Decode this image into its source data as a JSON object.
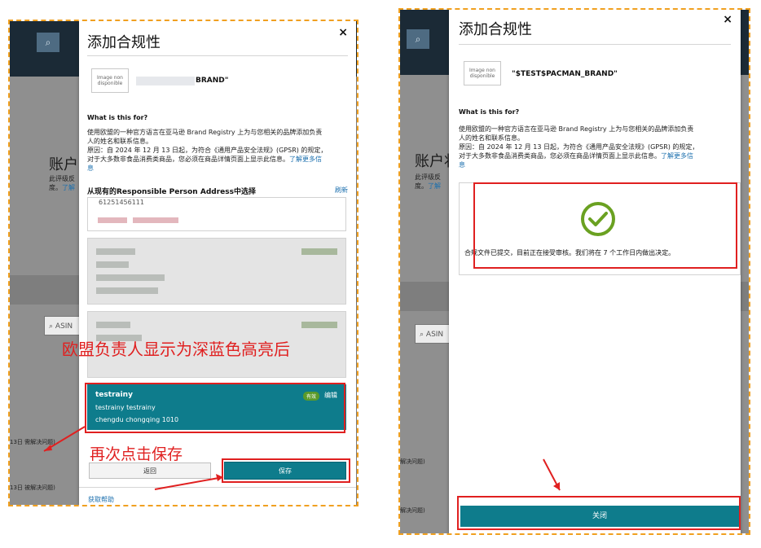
{
  "left": {
    "background": {
      "title_partial": "账户",
      "sub_partial": "此评级反",
      "sub_partial2": "度。",
      "sub_link": "了解",
      "asin_placeholder": "ASIN",
      "note1": "13日 需解决问题)",
      "note2": "13日 被解决问题)"
    },
    "modal": {
      "title": "添加合规性",
      "close": "×",
      "image_placeholder": "Image non disponible",
      "brand_suffix": "BRAND\"",
      "what_for": "What is this for?",
      "desc_line1": "使用欧盟的一种官方语言在亚马逊 Brand Registry 上为与您相关的品牌添加负责",
      "desc_line2": "人的姓名和联系信息。",
      "desc_line3": "原因：自 2024 年 12 月 13 日起，为符合《通用产品安全法规》(GPSR) 的规定，",
      "desc_line4": "对于大多数非食品消费类商品，您必须在商品详情页面上显示此信息。",
      "learn_more": "了解更多信",
      "learn_more2": "息",
      "select_heading": "从现有的Responsible Person Address中选择",
      "refresh": "刷新",
      "phone": "61251456111",
      "selected": {
        "name": "testrainy",
        "badge": "有效",
        "edit": "编辑",
        "line1": "testrainy testrainy",
        "line2": "chengdu chongqing 1010"
      },
      "back_button": "返回",
      "save_button": "保存",
      "help": "获取帮助"
    },
    "annotations": {
      "highlight_text": "欧盟负责人显示为深蓝色高亮后",
      "click_save_text": "再次点击保存"
    }
  },
  "right": {
    "background": {
      "title_partial": "账户状",
      "sub_partial": "此评级反",
      "sub_partial2": "度。",
      "sub_link": "了解",
      "asin_placeholder": "ASIN",
      "note1": "解决问题)",
      "note2": "解决问题)"
    },
    "modal": {
      "title": "添加合规性",
      "close": "×",
      "image_placeholder": "Image non disponible",
      "brand": "\"$TEST$PACMAN_BRAND\"",
      "what_for": "What is this for?",
      "desc_line1": "使用欧盟的一种官方语言在亚马逊 Brand Registry 上为与您相关的品牌添加负责",
      "desc_line2": "人的姓名和联系信息。",
      "desc_line3": "原因：自 2024 年 12 月 13 日起，为符合《通用产品安全法规》(GPSR) 的规定，",
      "desc_line4": "对于大多数非食品消费类商品，您必须在商品详情页面上显示此信息。",
      "learn_more": "了解更多信",
      "learn_more2": "息",
      "success_message": "合规文件已提交，目前正在接受审核。我们将在 7 个工作日内做出决定。",
      "close_button": "关闭"
    }
  },
  "colors": {
    "accent": "#0e7c8c",
    "annotation": "#e02020",
    "frame": "#f0a020",
    "success": "#6aa121"
  }
}
